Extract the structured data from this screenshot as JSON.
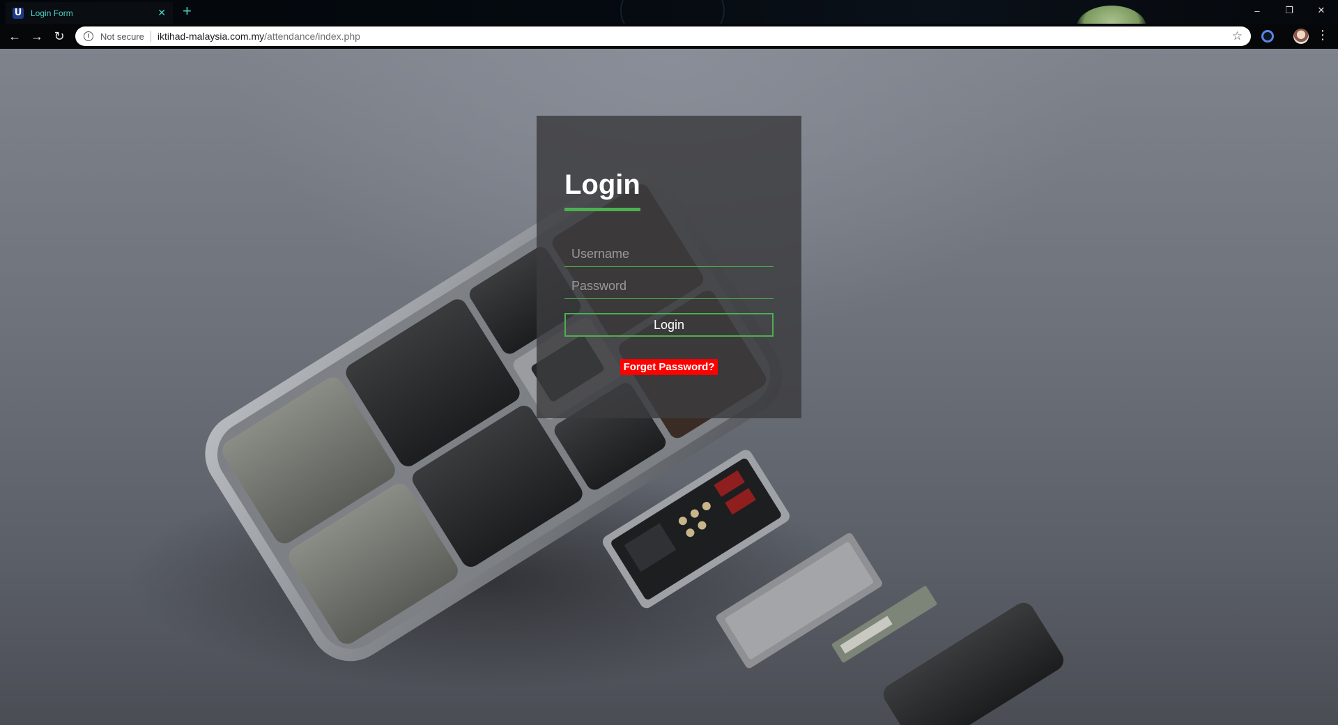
{
  "browser": {
    "tab": {
      "title": "Login Form",
      "favicon": "U"
    },
    "address": {
      "security_label": "Not secure",
      "host": "iktihad-malaysia.com.my",
      "path": "/attendance/index.php"
    },
    "window_controls": {
      "minimize": "–",
      "restore": "❐",
      "close": "✕"
    }
  },
  "login": {
    "title": "Login",
    "username_placeholder": "Username",
    "password_placeholder": "Password",
    "submit_label": "Login",
    "forgot_label": "Forget Password?"
  },
  "colors": {
    "accent": "#4caf50",
    "danger": "#ff0000",
    "tab_text": "#49d0c3"
  }
}
